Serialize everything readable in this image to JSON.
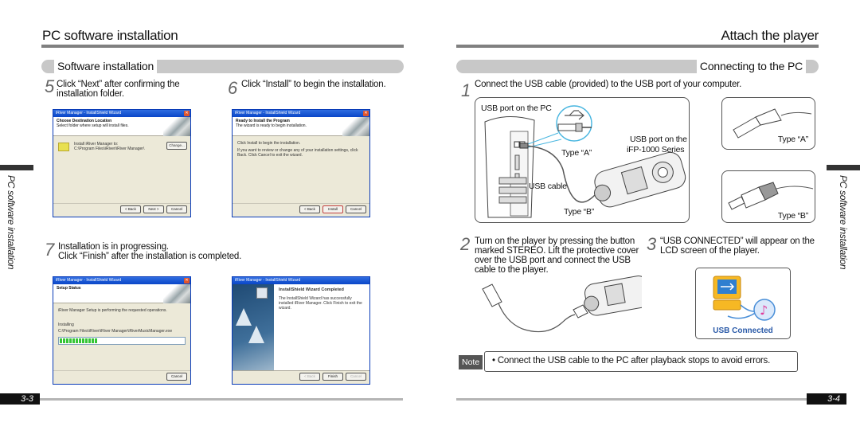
{
  "left_page": {
    "title": "PC software installation",
    "section": "Software installation",
    "side_label": "PC software installation",
    "page_number": "3-3",
    "steps": [
      {
        "num": "5",
        "text_line1": "Click “Next” after confirming the",
        "text_line2": "installation folder."
      },
      {
        "num": "6",
        "text_line1": "Click “Install” to begin the installation."
      },
      {
        "num": "7",
        "text_line1": "Installation is in progressing.",
        "text_line2": "Click “Finish” after the installation is completed."
      }
    ],
    "dialogs": [
      {
        "title": "iRiver Manager - InstallShield Wizard",
        "heading": "Choose Destination Location",
        "subheading": "Select folder where setup will install files.",
        "body1": "Install iRiver Manager to:",
        "body2": "C:\\Program Files\\iRiver\\iRiver Manager\\",
        "change_button": "Change...",
        "buttons": [
          "< Back",
          "Next >",
          "Cancel"
        ]
      },
      {
        "title": "iRiver Manager - InstallShield Wizard",
        "heading": "Ready to Install the Program",
        "subheading": "The wizard is ready to begin installation.",
        "body1": "Click Install to begin the installation.",
        "body2": "If you want to review or change any of your installation settings, click Back. Click Cancel to exit the wizard.",
        "buttons": [
          "< Back",
          "Install",
          "Cancel"
        ]
      },
      {
        "title": "iRiver Manager - InstallShield Wizard",
        "heading": "Setup Status",
        "body1": "iRiver Manager Setup is performing the requested operations.",
        "body2": "Installing",
        "body3": "C:\\Program Files\\iRiver\\iRiver Manager\\iRiverMusicManager.exe",
        "progress": 0.3,
        "buttons": [
          "Cancel"
        ]
      },
      {
        "title": "iRiver Manager - InstallShield Wizard",
        "heading": "InstallShield Wizard Completed",
        "body1": "The InstallShield Wizard has successfully installed iRiver Manager. Click Finish to exit the wizard.",
        "buttons": [
          "< Back",
          "Finish",
          "Cancel"
        ]
      }
    ]
  },
  "right_page": {
    "title": "Attach the player",
    "section": "Connecting to the PC",
    "side_label": "PC software installation",
    "page_number": "3-4",
    "steps": [
      {
        "num": "1",
        "text_line1": "Connect the USB cable (provided) to the USB port of your computer."
      },
      {
        "num": "2",
        "text_line1": "Turn on the player by pressing the button",
        "text_line2": "marked STEREO.  Lift the protective cover",
        "text_line3": "over the USB port and connect the USB",
        "text_line4": "cable to the player."
      },
      {
        "num": "3",
        "text_line1": "“USB CONNECTED” will appear on the",
        "text_line2": "LCD screen of the player."
      }
    ],
    "figure_labels": {
      "usb_port_pc": "USB port on the PC",
      "type_a": "Type “A”",
      "usb_port_player_1": "USB port on the",
      "usb_port_player_2": "iFP-1000 Series",
      "usb_cable": "USB cable",
      "type_b": "Type “B”",
      "type_a_box": "Type “A”",
      "type_b_box": "Type “B”",
      "usb_connected": "USB Connected"
    },
    "note": {
      "tag": "Note",
      "text": "• Connect the USB cable to the PC after playback stops to avoid errors."
    }
  },
  "colors": {
    "rule": "#808080",
    "section_bar": "#c8c8c8",
    "usb_connected_text": "#2a5aa8",
    "xp_title": "#0a46c8"
  }
}
